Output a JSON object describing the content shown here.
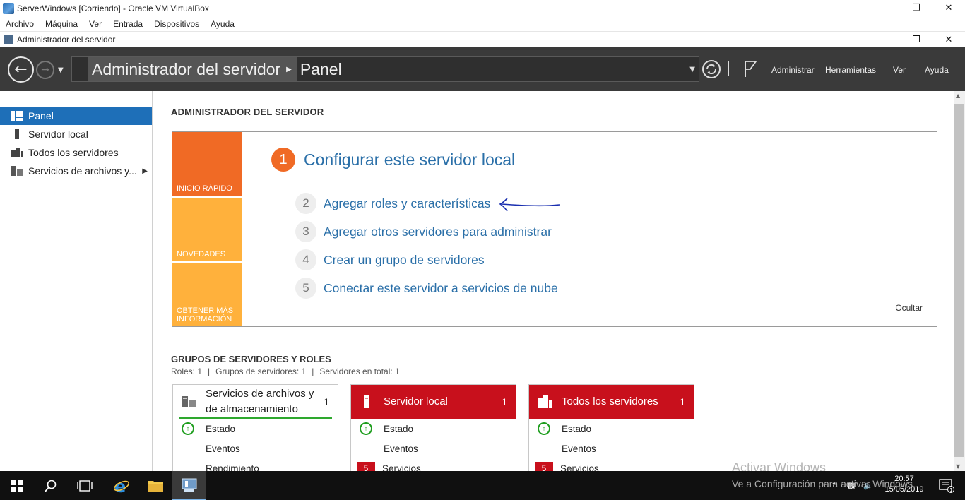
{
  "vbox": {
    "title": "ServerWindows [Corriendo] - Oracle VM VirtualBox",
    "menu": [
      "Archivo",
      "Máquina",
      "Ver",
      "Entrada",
      "Dispositivos",
      "Ayuda"
    ]
  },
  "window_controls": {
    "minimize": "—",
    "restore": "❐",
    "close": "✕"
  },
  "sm": {
    "title": "Administrador del servidor",
    "breadcrumb": [
      "Administrador del servidor",
      "Panel"
    ],
    "header_menu": [
      "Administrar",
      "Herramientas",
      "Ver",
      "Ayuda"
    ]
  },
  "sidebar": {
    "items": [
      {
        "label": "Panel",
        "icon": "dashboard-icon",
        "active": true
      },
      {
        "label": "Servidor local",
        "icon": "server-icon"
      },
      {
        "label": "Todos los servidores",
        "icon": "servers-icon"
      },
      {
        "label": "Servicios de archivos y...",
        "icon": "file-services-icon",
        "expandable": true
      }
    ]
  },
  "main": {
    "section_title": "ADMINISTRADOR DEL SERVIDOR",
    "quick_tabs": [
      "INICIO RÁPIDO",
      "NOVEDADES",
      "OBTENER MÁS INFORMACIÓN"
    ],
    "step1": {
      "num": "1",
      "label": "Configurar este servidor local"
    },
    "steps": [
      {
        "num": "2",
        "label": "Agregar roles y características"
      },
      {
        "num": "3",
        "label": "Agregar otros servidores para administrar"
      },
      {
        "num": "4",
        "label": "Crear un grupo de servidores"
      },
      {
        "num": "5",
        "label": "Conectar este servidor a servicios de nube"
      }
    ],
    "hide": "Ocultar",
    "groups_title": "GRUPOS DE SERVIDORES Y ROLES",
    "groups_sub": [
      "Roles: 1",
      "Grupos de servidores: 1",
      "Servidores en total: 1"
    ]
  },
  "tiles": [
    {
      "name_line1": "Servicios de archivos y",
      "name_line2": "de almacenamiento",
      "count": "1",
      "rows": [
        {
          "label": "Estado",
          "status": "ok"
        },
        {
          "label": "Eventos"
        },
        {
          "label": "Rendimiento"
        }
      ]
    },
    {
      "name": "Servidor local",
      "count": "1",
      "rows": [
        {
          "label": "Estado",
          "status": "ok"
        },
        {
          "label": "Eventos"
        },
        {
          "label": "Servicios",
          "badge": "5"
        }
      ]
    },
    {
      "name": "Todos los servidores",
      "count": "1",
      "rows": [
        {
          "label": "Estado",
          "status": "ok"
        },
        {
          "label": "Eventos"
        },
        {
          "label": "Servicios",
          "badge": "5"
        }
      ]
    }
  ],
  "watermark": {
    "line1": "Activar Windows",
    "line2": "Ve a Configuración para activar Windows."
  },
  "taskbar": {
    "time": "20:57",
    "date": "15/05/2019",
    "notif_count": "1"
  },
  "colors": {
    "accent_blue": "#1e6fb8",
    "orange": "#f06a25",
    "amber": "#ffb13c",
    "tile_red": "#c8101c",
    "status_green": "#1f9e1f"
  }
}
